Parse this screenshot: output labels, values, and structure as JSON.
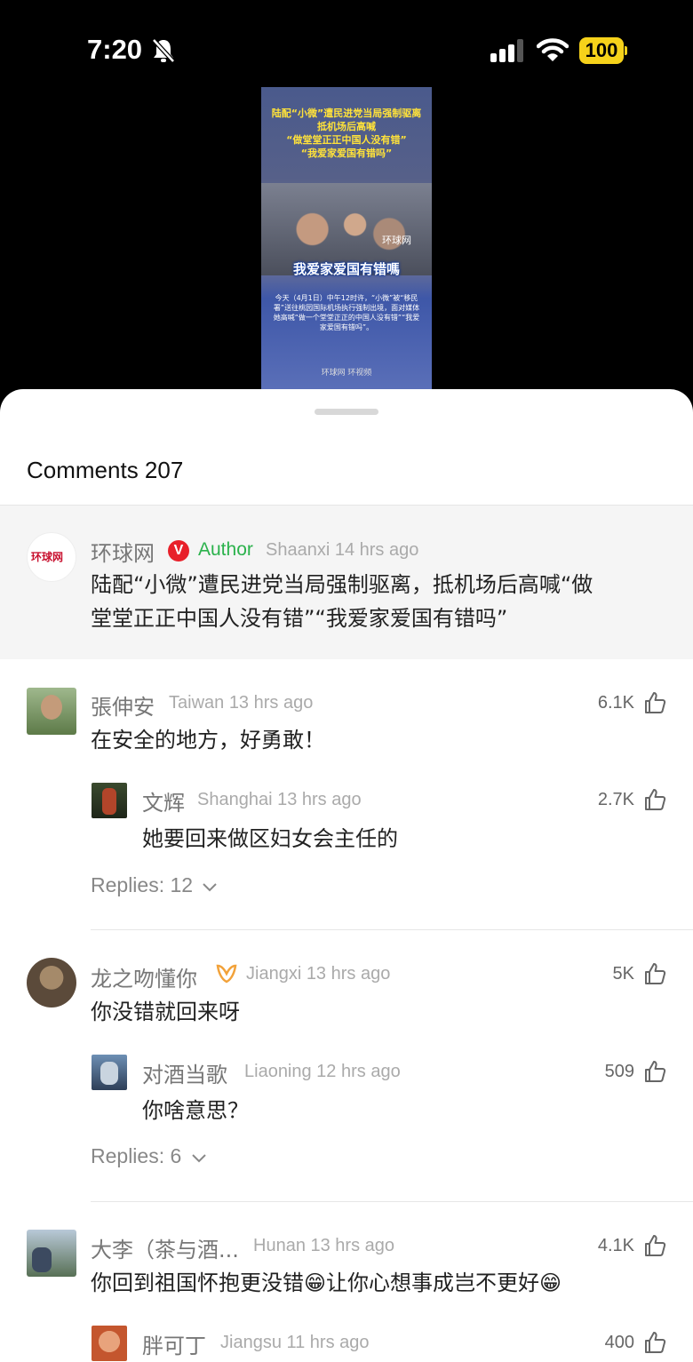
{
  "status_bar": {
    "time": "7:20",
    "battery": "100"
  },
  "video": {
    "caption_top": "陆配“小微”遭民进党当局强制驱离\n抵机场后高喊\n“做堂堂正正中国人没有错”\n“我爱家爱国有错吗”",
    "caption_mid": "我爱家爱国有错嗎",
    "watermark": "环球网",
    "body": "今天（4月1日）中午12时许，“小微”被“移民署”送往桃园国际机场执行强制出境，面对媒体她高喊“做一个堂堂正正的中国人没有错”“我爱家爱国有错吗”。",
    "footer": "环球网  环视频"
  },
  "comments_title": "Comments 207",
  "author_comment": {
    "avatar_logo": "环球网",
    "name": "环球网",
    "badge": "V",
    "author_label": "Author",
    "meta": "Shaanxi 14 hrs ago",
    "text_line1": "陆配“小微”遭民进党当局强制驱离，抵机场后高喊“做",
    "text_line2": "堂堂正正中国人没有错”“我爱家爱国有错吗”"
  },
  "comments": [
    {
      "name": "張伸安",
      "meta": "Taiwan 13 hrs ago",
      "likes": "6.1K",
      "text": "在安全的地方，好勇敢！",
      "reply": {
        "name": "文辉",
        "meta": "Shanghai 13 hrs ago",
        "likes": "2.7K",
        "text": "她要回来做区妇女会主任的"
      },
      "replies_label": "Replies: 12"
    },
    {
      "name": "龙之吻懂你",
      "meta": "Jiangxi 13 hrs ago",
      "likes": "5K",
      "text": "你没错就回来呀",
      "reply": {
        "name": "对酒当歌",
        "meta": "Liaoning 12 hrs ago",
        "likes": "509",
        "text": "你啥意思？"
      },
      "replies_label": "Replies: 6"
    },
    {
      "name": "大李（茶与酒...",
      "meta": "Hunan 13 hrs ago",
      "likes": "4.1K",
      "text": "你回到祖国怀抱更没错😁让你心想事成岂不更好😁",
      "reply": {
        "name": "胖可丁",
        "meta": "Jiangsu 11 hrs ago",
        "likes": "400"
      }
    }
  ],
  "colors": {
    "author_green": "#2bb24c",
    "badge_red": "#e8202a",
    "battery_yellow": "#f6d21a"
  }
}
